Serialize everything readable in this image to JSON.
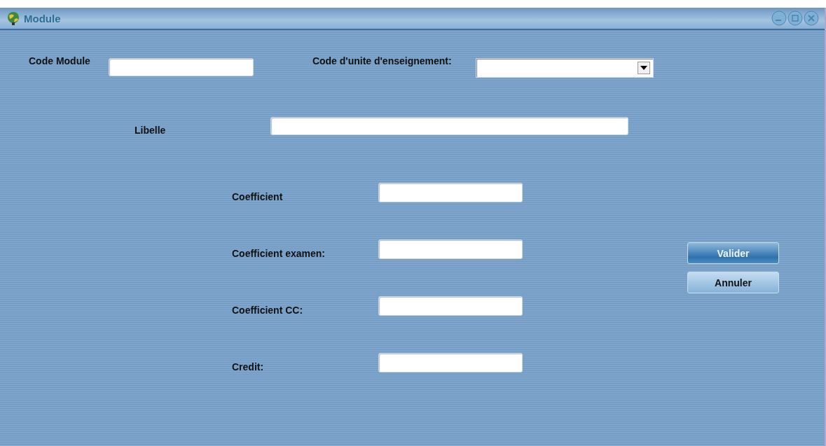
{
  "window": {
    "title": "Module"
  },
  "header_fields": [
    {
      "label": "Code Module",
      "kind": "text"
    },
    {
      "label": "Code d'unite d'enseignement:",
      "kind": "combo"
    }
  ],
  "libelle": {
    "label": "Libelle"
  },
  "coefficients": [
    {
      "label": "Coefficient"
    },
    {
      "label": "Coefficient examen:"
    },
    {
      "label": "Coefficient CC:"
    },
    {
      "label": "Credit:"
    }
  ],
  "buttons": [
    {
      "label": "Valider",
      "default": true
    },
    {
      "label": "Annuler",
      "default": false
    }
  ]
}
